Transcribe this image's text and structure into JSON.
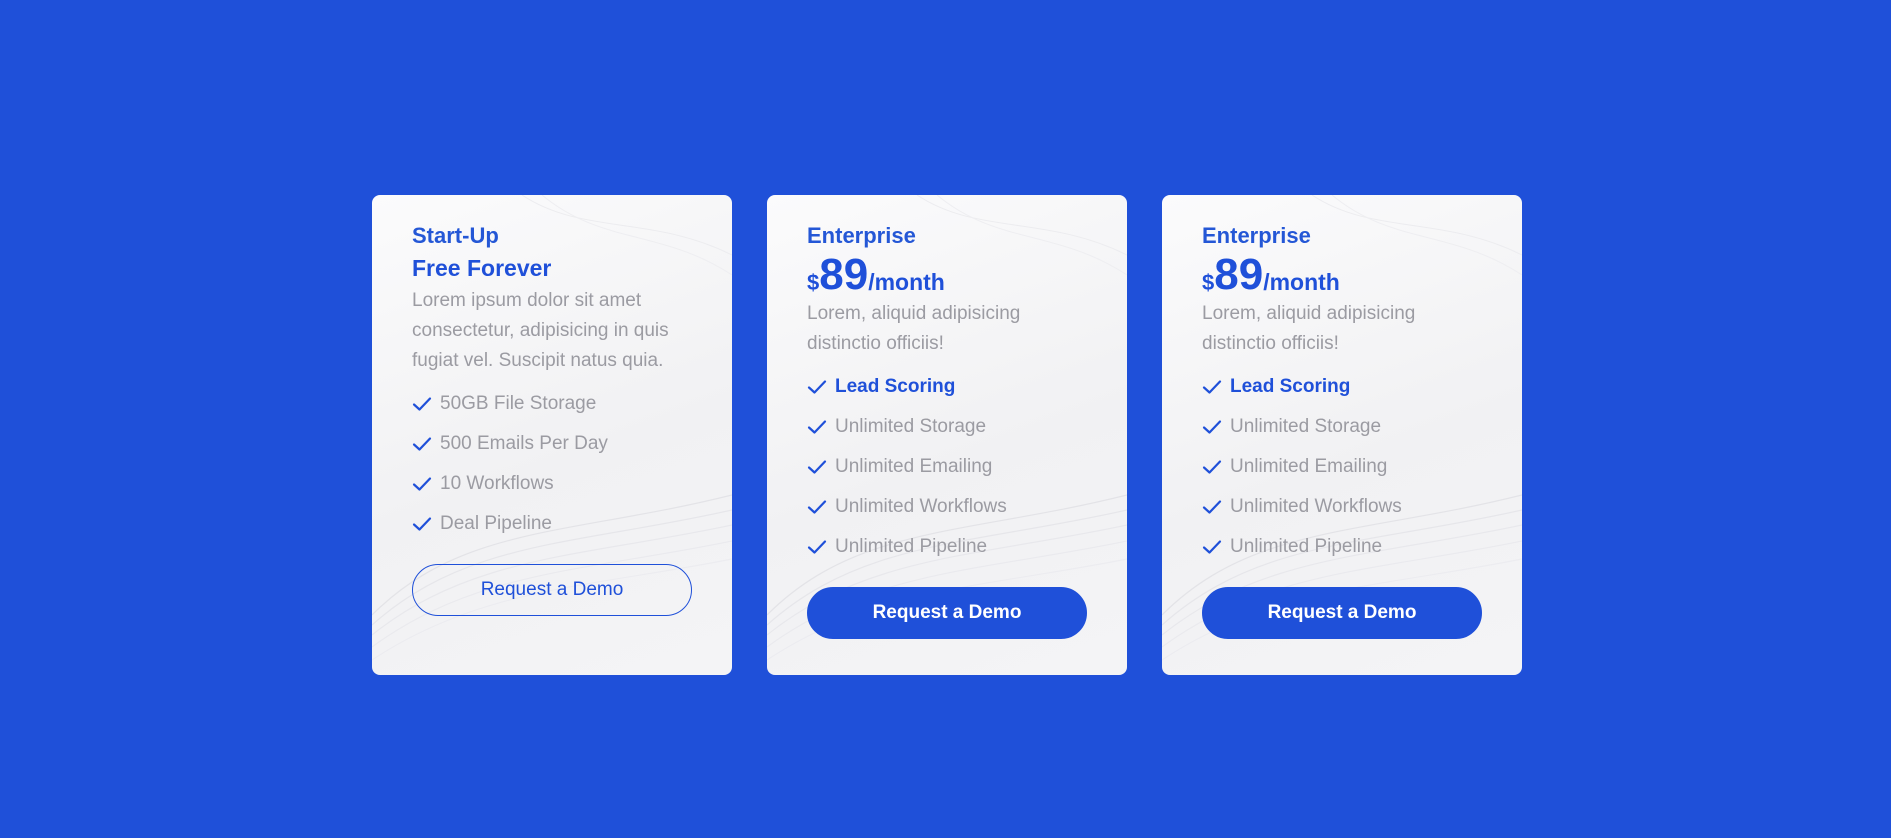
{
  "colors": {
    "background": "#1f50d9",
    "accent": "#1f50d9",
    "card": "#f4f4f6",
    "muted_text": "#9b9ba2"
  },
  "cards": [
    {
      "plan_name": "Start-Up",
      "price_text": "Free Forever",
      "description": "Lorem ipsum dolor sit amet consectetur, adipisicing in quis fugiat vel. Suscipit natus quia.",
      "features": [
        {
          "label": "50GB File Storage",
          "icon": "check-icon"
        },
        {
          "label": "500 Emails Per Day",
          "icon": "check-icon"
        },
        {
          "label": "10 Workflows",
          "icon": "check-icon"
        },
        {
          "label": "Deal Pipeline",
          "icon": "check-icon"
        }
      ],
      "button_label": "Request a Demo",
      "button_style": "outline"
    },
    {
      "plan_name": "Enterprise",
      "price": {
        "currency": "$",
        "amount": "89",
        "period": "/month"
      },
      "description": "Lorem, aliquid adipisicing distinctio officiis!",
      "features": [
        {
          "label": "Lead Scoring",
          "icon": "check-icon",
          "highlight": true
        },
        {
          "label": "Unlimited Storage",
          "icon": "check-icon"
        },
        {
          "label": "Unlimited Emailing",
          "icon": "check-icon"
        },
        {
          "label": "Unlimited Workflows",
          "icon": "check-icon"
        },
        {
          "label": "Unlimited Pipeline",
          "icon": "check-icon"
        }
      ],
      "button_label": "Request a Demo",
      "button_style": "solid"
    },
    {
      "plan_name": "Enterprise",
      "price": {
        "currency": "$",
        "amount": "89",
        "period": "/month"
      },
      "description": "Lorem, aliquid adipisicing distinctio officiis!",
      "features": [
        {
          "label": "Lead Scoring",
          "icon": "check-icon",
          "highlight": true
        },
        {
          "label": "Unlimited Storage",
          "icon": "check-icon"
        },
        {
          "label": "Unlimited Emailing",
          "icon": "check-icon"
        },
        {
          "label": "Unlimited Workflows",
          "icon": "check-icon"
        },
        {
          "label": "Unlimited Pipeline",
          "icon": "check-icon"
        }
      ],
      "button_label": "Request a Demo",
      "button_style": "solid"
    }
  ]
}
